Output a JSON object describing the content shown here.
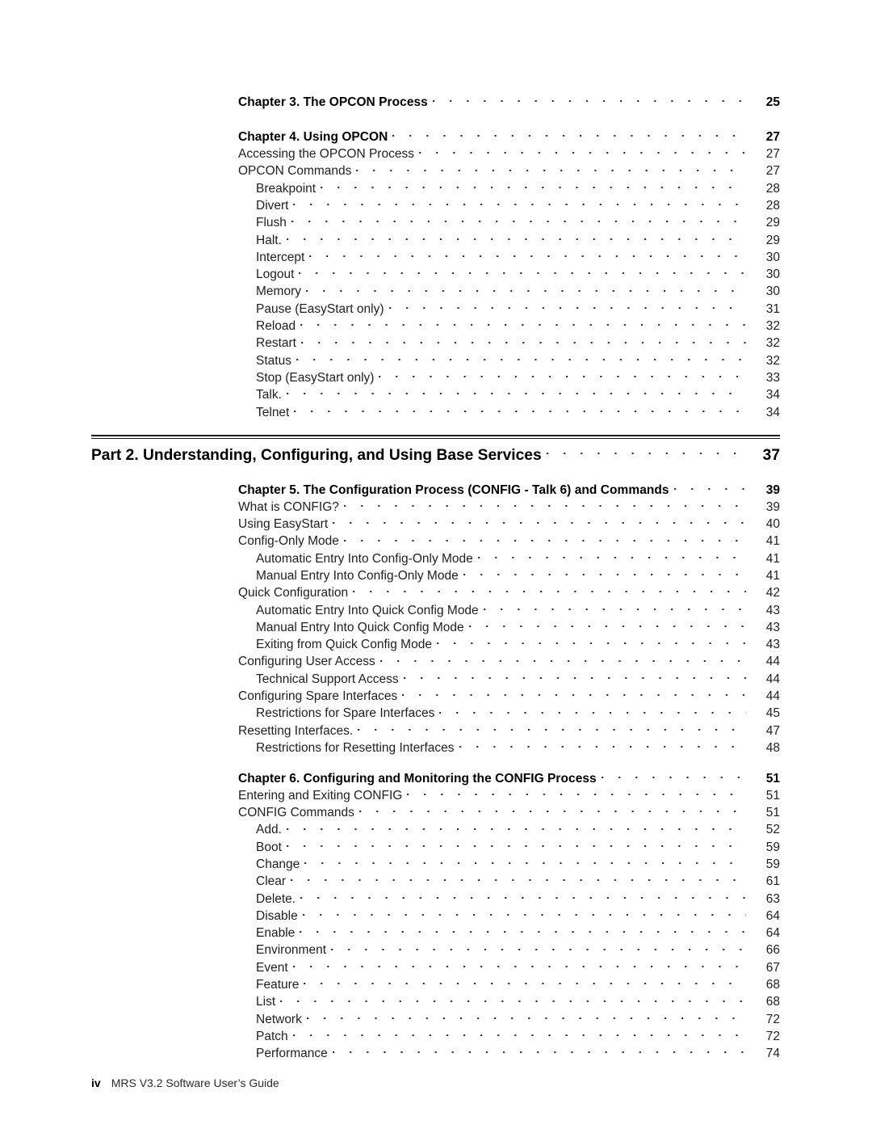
{
  "document": {
    "page_label": "iv",
    "running_footer": "MRS V3.2 Software User’s Guide"
  },
  "toc": {
    "group_1": [
      {
        "label": "Chapter 3. The OPCON Process",
        "page": "25",
        "level": 0,
        "style": "chapter"
      },
      {
        "label": "Chapter 4. Using OPCON",
        "page": "27",
        "level": 0,
        "style": "chapter"
      },
      {
        "label": "Accessing the OPCON Process",
        "page": "27",
        "level": 0,
        "style": "normal"
      },
      {
        "label": "OPCON Commands",
        "page": "27",
        "level": 0,
        "style": "normal"
      },
      {
        "label": "Breakpoint",
        "page": "28",
        "level": 1,
        "style": "normal"
      },
      {
        "label": "Divert",
        "page": "28",
        "level": 1,
        "style": "normal"
      },
      {
        "label": "Flush",
        "page": "29",
        "level": 1,
        "style": "normal"
      },
      {
        "label": "Halt.",
        "page": "29",
        "level": 1,
        "style": "normal"
      },
      {
        "label": "Intercept",
        "page": "30",
        "level": 1,
        "style": "normal"
      },
      {
        "label": "Logout",
        "page": "30",
        "level": 1,
        "style": "normal"
      },
      {
        "label": "Memory",
        "page": "30",
        "level": 1,
        "style": "normal"
      },
      {
        "label": "Pause (EasyStart only)",
        "page": "31",
        "level": 1,
        "style": "normal"
      },
      {
        "label": "Reload",
        "page": "32",
        "level": 1,
        "style": "normal"
      },
      {
        "label": "Restart",
        "page": "32",
        "level": 1,
        "style": "normal"
      },
      {
        "label": "Status",
        "page": "32",
        "level": 1,
        "style": "normal"
      },
      {
        "label": "Stop (EasyStart only)",
        "page": "33",
        "level": 1,
        "style": "normal"
      },
      {
        "label": "Talk.",
        "page": "34",
        "level": 1,
        "style": "normal"
      },
      {
        "label": "Telnet",
        "page": "34",
        "level": 1,
        "style": "normal"
      }
    ],
    "part_heading": {
      "label": "Part 2. Understanding, Configuring, and Using Base Services",
      "page": "37"
    },
    "group_2": [
      {
        "label": "Chapter 5. The Configuration Process (CONFIG - Talk 6) and Commands",
        "page": "39",
        "level": 0,
        "style": "chapter"
      },
      {
        "label": "What is CONFIG?",
        "page": "39",
        "level": 0,
        "style": "normal"
      },
      {
        "label": "Using EasyStart",
        "page": "40",
        "level": 0,
        "style": "normal"
      },
      {
        "label": "Config-Only Mode",
        "page": "41",
        "level": 0,
        "style": "normal"
      },
      {
        "label": "Automatic Entry Into Config-Only Mode",
        "page": "41",
        "level": 1,
        "style": "normal"
      },
      {
        "label": "Manual Entry Into Config-Only Mode",
        "page": "41",
        "level": 1,
        "style": "normal"
      },
      {
        "label": "Quick Configuration",
        "page": "42",
        "level": 0,
        "style": "normal"
      },
      {
        "label": "Automatic Entry Into Quick Config Mode",
        "page": "43",
        "level": 1,
        "style": "normal"
      },
      {
        "label": "Manual Entry Into Quick Config Mode",
        "page": "43",
        "level": 1,
        "style": "normal"
      },
      {
        "label": "Exiting from Quick Config Mode",
        "page": "43",
        "level": 1,
        "style": "normal"
      },
      {
        "label": "Configuring User Access",
        "page": "44",
        "level": 0,
        "style": "normal"
      },
      {
        "label": "Technical Support Access",
        "page": "44",
        "level": 1,
        "style": "normal"
      },
      {
        "label": "Configuring Spare Interfaces",
        "page": "44",
        "level": 0,
        "style": "normal"
      },
      {
        "label": "Restrictions for Spare Interfaces",
        "page": "45",
        "level": 1,
        "style": "normal"
      },
      {
        "label": "Resetting Interfaces.",
        "page": "47",
        "level": 0,
        "style": "normal"
      },
      {
        "label": "Restrictions for Resetting Interfaces",
        "page": "48",
        "level": 1,
        "style": "normal"
      }
    ],
    "group_3": [
      {
        "label": "Chapter 6. Configuring and Monitoring the CONFIG Process",
        "page": "51",
        "level": 0,
        "style": "chapter"
      },
      {
        "label": "Entering and Exiting CONFIG",
        "page": "51",
        "level": 0,
        "style": "normal"
      },
      {
        "label": "CONFIG Commands",
        "page": "51",
        "level": 0,
        "style": "normal"
      },
      {
        "label": "Add.",
        "page": "52",
        "level": 1,
        "style": "normal"
      },
      {
        "label": "Boot",
        "page": "59",
        "level": 1,
        "style": "normal"
      },
      {
        "label": "Change",
        "page": "59",
        "level": 1,
        "style": "normal"
      },
      {
        "label": "Clear",
        "page": "61",
        "level": 1,
        "style": "normal"
      },
      {
        "label": "Delete.",
        "page": "63",
        "level": 1,
        "style": "normal"
      },
      {
        "label": "Disable",
        "page": "64",
        "level": 1,
        "style": "normal"
      },
      {
        "label": "Enable",
        "page": "64",
        "level": 1,
        "style": "normal"
      },
      {
        "label": "Environment",
        "page": "66",
        "level": 1,
        "style": "normal"
      },
      {
        "label": "Event",
        "page": "67",
        "level": 1,
        "style": "normal"
      },
      {
        "label": "Feature",
        "page": "68",
        "level": 1,
        "style": "normal"
      },
      {
        "label": "List",
        "page": "68",
        "level": 1,
        "style": "normal"
      },
      {
        "label": "Network",
        "page": "72",
        "level": 1,
        "style": "normal"
      },
      {
        "label": "Patch",
        "page": "72",
        "level": 1,
        "style": "normal"
      },
      {
        "label": "Performance",
        "page": "74",
        "level": 1,
        "style": "normal"
      }
    ]
  }
}
